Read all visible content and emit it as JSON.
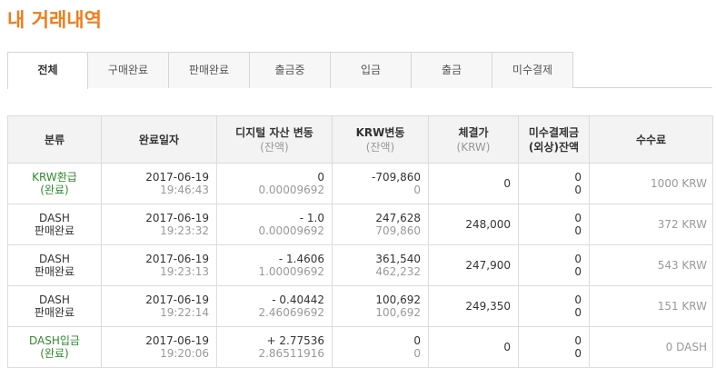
{
  "page": {
    "title": "내 거래내역"
  },
  "tabs": [
    {
      "label": "전체",
      "active": true
    },
    {
      "label": "구매완료",
      "active": false
    },
    {
      "label": "판매완료",
      "active": false
    },
    {
      "label": "출금중",
      "active": false
    },
    {
      "label": "입금",
      "active": false
    },
    {
      "label": "출금",
      "active": false
    },
    {
      "label": "미수결제",
      "active": false
    }
  ],
  "table": {
    "headers": {
      "category": "분류",
      "date": "완료일자",
      "asset": "디지털 자산 변동",
      "asset_sub": "(잔액)",
      "krw": "KRW변동",
      "krw_sub": "(잔액)",
      "price": "체결가",
      "price_sub": "(KRW)",
      "unpaid": "미수결제금",
      "unpaid_sub": "(외상)잔액",
      "fee": "수수료"
    },
    "rows": [
      {
        "cat1": "KRW환급",
        "cat2": "(완료)",
        "green": true,
        "date": "2017-06-19",
        "time": "19:46:43",
        "asset": "0",
        "asset_bal": "0.00009692",
        "krw": "-709,860",
        "krw_bal": "0",
        "price": "0",
        "unpaid": "0",
        "unpaid_bal": "0",
        "fee": "1000 KRW"
      },
      {
        "cat1": "DASH",
        "cat2": "판매완료",
        "green": false,
        "date": "2017-06-19",
        "time": "19:23:32",
        "asset": "- 1.0",
        "asset_bal": "0.00009692",
        "krw": "247,628",
        "krw_bal": "709,860",
        "price": "248,000",
        "unpaid": "0",
        "unpaid_bal": "0",
        "fee": "372 KRW"
      },
      {
        "cat1": "DASH",
        "cat2": "판매완료",
        "green": false,
        "date": "2017-06-19",
        "time": "19:23:13",
        "asset": "- 1.4606",
        "asset_bal": "1.00009692",
        "krw": "361,540",
        "krw_bal": "462,232",
        "price": "247,900",
        "unpaid": "0",
        "unpaid_bal": "0",
        "fee": "543 KRW"
      },
      {
        "cat1": "DASH",
        "cat2": "판매완료",
        "green": false,
        "date": "2017-06-19",
        "time": "19:22:14",
        "asset": "- 0.40442",
        "asset_bal": "2.46069692",
        "krw": "100,692",
        "krw_bal": "100,692",
        "price": "249,350",
        "unpaid": "0",
        "unpaid_bal": "0",
        "fee": "151 KRW"
      },
      {
        "cat1": "DASH입금",
        "cat2": "(완료)",
        "green": true,
        "date": "2017-06-19",
        "time": "19:20:06",
        "asset": "+ 2.77536",
        "asset_bal": "2.86511916",
        "krw": "0",
        "krw_bal": "0",
        "price": "0",
        "unpaid": "0",
        "unpaid_bal": "0",
        "fee": "0 DASH"
      }
    ]
  }
}
